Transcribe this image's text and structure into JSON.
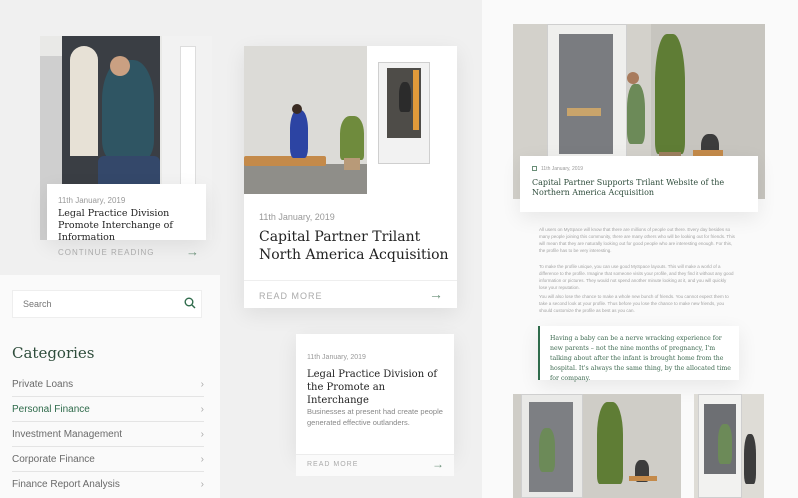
{
  "card_small": {
    "date": "11th January, 2019",
    "title": "Legal Practice Division Promote Interchange of Information",
    "more": "CONTINUE READING"
  },
  "card_main": {
    "date": "11th January, 2019",
    "title": "Capital Partner Trilant North America Acquisition",
    "more": "READ MORE"
  },
  "card_text": {
    "date": "11th January, 2019",
    "title": "Legal Practice Division of the Promote an Interchange",
    "excerpt": "Businesses at present had create people generated effective outlanders.",
    "more": "READ MORE"
  },
  "sidebar": {
    "search_placeholder": "Search",
    "categories_title": "Categories",
    "items": [
      {
        "label": "Private Loans",
        "active": false
      },
      {
        "label": "Personal Finance",
        "active": true
      },
      {
        "label": "Investment Management",
        "active": false
      },
      {
        "label": "Corporate Finance",
        "active": false
      },
      {
        "label": "Finance Report Analysis",
        "active": false
      }
    ]
  },
  "article": {
    "date": "11th January, 2019",
    "title": "Capital Partner Supports Trilant Website of the Northern America Acquisition",
    "paragraphs": [
      "All users on MySpace will know that there are millions of people out there. Every day besides so many people joining this community, there are many others who will be looking out for friends. This will mean that they are naturally looking out for good people who are interesting enough. For this, the profile has to be very interesting.",
      "To make the profile unique, you can use good MySpace layouts. This will make a world of a difference to the profile. Imagine that someone visits your profile, and they find it without any good information or pictures. They would not spend another minute looking at it, and you will quickly lose your reputation.",
      "You will also lose the chance to make a whole new bunch of friends. You cannot expect them to take a second look at your profile. Thus before you lose the chance to make new friends, you should customize the profile as best as you can."
    ],
    "quote": "Having a baby can be a nerve wracking experience for new parents – not the nine months of pregnancy, I'm talking about after the infant is brought home from the hospital. It's always the same thing, by the allocated time for company."
  },
  "colors": {
    "accent": "#2f6b4b",
    "bg": "#f0f0f0"
  }
}
